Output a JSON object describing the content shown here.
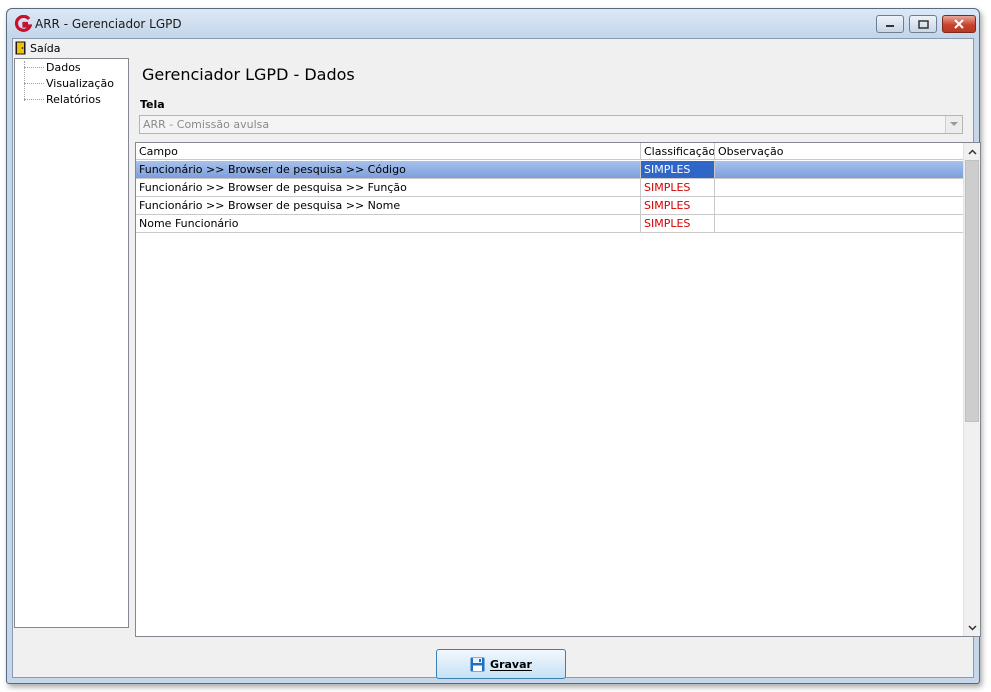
{
  "window": {
    "title": "ARR - Gerenciador LGPD"
  },
  "menu": {
    "exit_label": "Saída"
  },
  "tree": {
    "items": [
      "Dados",
      "Visualização",
      "Relatórios"
    ]
  },
  "main": {
    "heading": "Gerenciador LGPD - Dados",
    "tela_label": "Tela",
    "tela_value": "ARR - Comissão avulsa"
  },
  "grid": {
    "columns": [
      "Campo",
      "Classificação",
      "Observação"
    ],
    "rows": [
      {
        "campo": "Funcionário >> Browser de pesquisa >> Código",
        "classificacao": "SIMPLES",
        "observacao": ""
      },
      {
        "campo": "Funcionário >> Browser de pesquisa >> Função",
        "classificacao": "SIMPLES",
        "observacao": ""
      },
      {
        "campo": "Funcionário >> Browser de pesquisa >> Nome",
        "classificacao": "SIMPLES",
        "observacao": ""
      },
      {
        "campo": "Nome Funcionário",
        "classificacao": "SIMPLES",
        "observacao": ""
      }
    ]
  },
  "footer": {
    "save_label": "Gravar"
  },
  "colors": {
    "accent": "#2f66c8",
    "classification_text": "#d40000",
    "brand_icon": "#c8102e"
  }
}
